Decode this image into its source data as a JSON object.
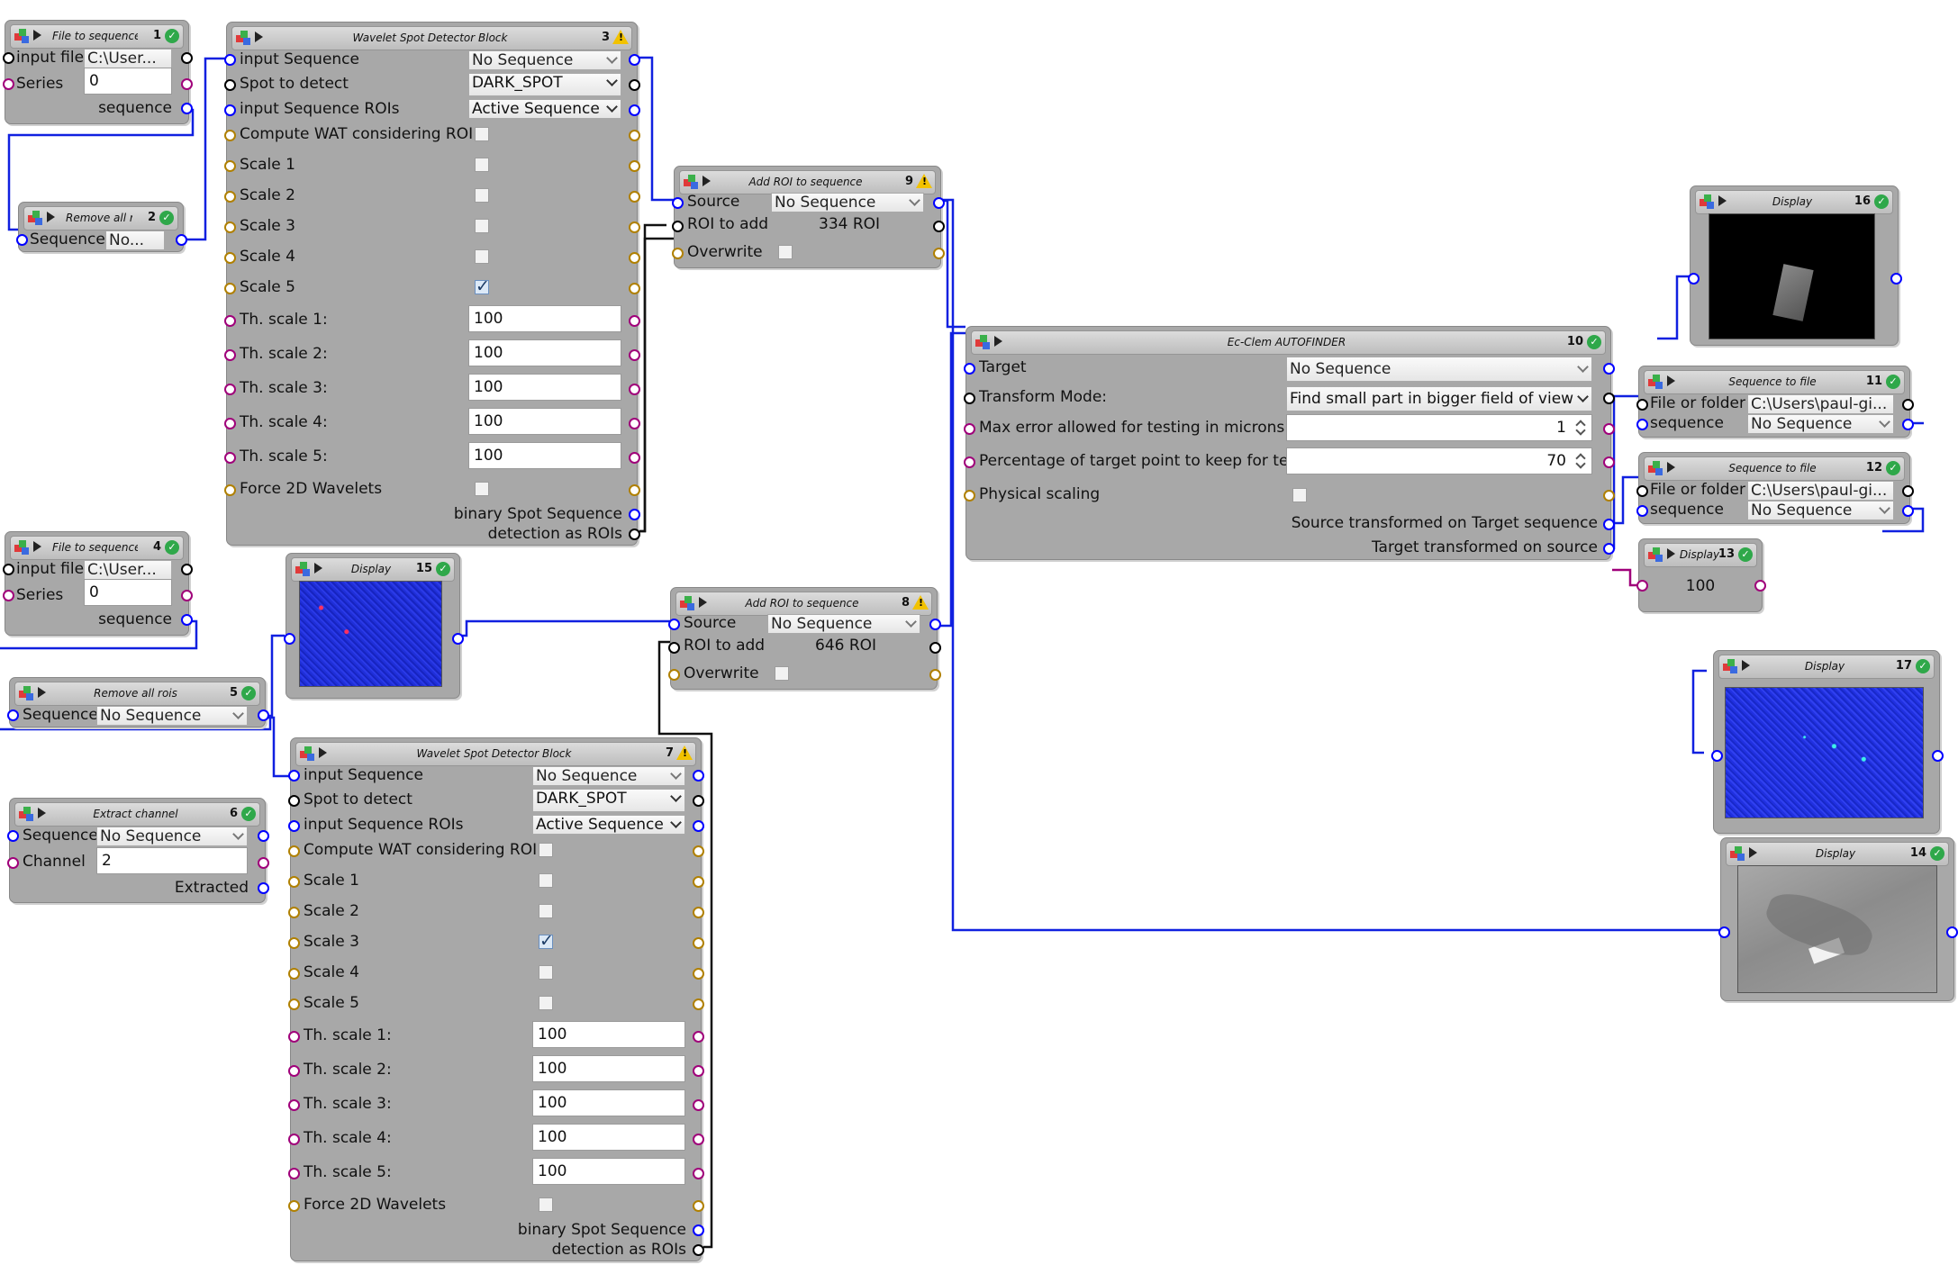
{
  "blocks": {
    "b1": {
      "title": "File to sequence",
      "num": "1",
      "labels": {
        "input_file": "input file",
        "series": "Series",
        "out": "sequence"
      },
      "values": {
        "file": "C:\\User...",
        "series": "0"
      }
    },
    "b2": {
      "title": "Remove all rois",
      "num": "2",
      "labels": {
        "seq": "Sequence"
      },
      "values": {
        "seq": "No..."
      }
    },
    "b3": {
      "title": "Wavelet Spot Detector Block",
      "num": "3",
      "rows": [
        "input Sequence",
        "Spot to detect",
        "input Sequence ROIs",
        "Compute WAT considering ROI",
        "Scale 1",
        "Scale 2",
        "Scale 3",
        "Scale 4",
        "Scale 5",
        "Th. scale 1:",
        "Th. scale 2:",
        "Th. scale 3:",
        "Th. scale 4:",
        "Th. scale 5:",
        "Force 2D Wavelets"
      ],
      "combos": [
        "No Sequence",
        "DARK_SPOT",
        "Active Sequence"
      ],
      "thresholds": [
        "100",
        "100",
        "100",
        "100",
        "100"
      ],
      "outputs": [
        "binary Spot Sequence",
        "detection as ROIs"
      ]
    },
    "b4": {
      "title": "File to sequence",
      "num": "4",
      "labels": {
        "input_file": "input file",
        "series": "Series",
        "out": "sequence"
      },
      "values": {
        "file": "C:\\User...",
        "series": "0"
      }
    },
    "b5": {
      "title": "Remove all rois",
      "num": "5",
      "labels": {
        "seq": "Sequence"
      },
      "values": {
        "seq": "No Sequence"
      }
    },
    "b6": {
      "title": "Extract channel",
      "num": "6",
      "labels": {
        "seq": "Sequence",
        "channel": "Channel",
        "out": "Extracted"
      },
      "values": {
        "seq": "No Sequence",
        "channel": "2"
      }
    },
    "b7": {
      "title": "Wavelet Spot Detector Block",
      "num": "7",
      "rows": [
        "input Sequence",
        "Spot to detect",
        "input Sequence ROIs",
        "Compute WAT considering ROI",
        "Scale 1",
        "Scale 2",
        "Scale 3",
        "Scale 4",
        "Scale 5",
        "Th. scale 1:",
        "Th. scale 2:",
        "Th. scale 3:",
        "Th. scale 4:",
        "Th. scale 5:",
        "Force 2D Wavelets"
      ],
      "combos": [
        "No Sequence",
        "DARK_SPOT",
        "Active Sequence"
      ],
      "thresholds": [
        "100",
        "100",
        "100",
        "100",
        "100"
      ],
      "outputs": [
        "binary Spot Sequence",
        "detection as ROIs"
      ]
    },
    "b8": {
      "title": "Add ROI to sequence",
      "num": "8",
      "labels": {
        "source": "Source",
        "roi": "ROI to add",
        "overwrite": "Overwrite"
      },
      "values": {
        "source": "No Sequence",
        "roi": "646 ROI"
      }
    },
    "b9": {
      "title": "Add ROI to sequence",
      "num": "9",
      "labels": {
        "source": "Source",
        "roi": "ROI to add",
        "overwrite": "Overwrite"
      },
      "values": {
        "source": "No Sequence",
        "roi": "334 ROI"
      }
    },
    "b10": {
      "title": "Ec-Clem AUTOFINDER",
      "num": "10",
      "labels": {
        "target": "Target",
        "mode": "Transform Mode:",
        "maxerr": "Max error allowed for testing in microns",
        "pct": "Percentage of target point to keep for test",
        "phys": "Physical scaling",
        "out1": "Source transformed on Target sequence",
        "out2": "Target transformed on source"
      },
      "values": {
        "target": "No Sequence",
        "mode": "Find small part in bigger field of view",
        "maxerr": "1",
        "pct": "70"
      }
    },
    "b11": {
      "title": "Sequence to file",
      "num": "11",
      "labels": {
        "file": "File or folder",
        "seq": "sequence"
      },
      "values": {
        "file": "C:\\Users\\paul-gi...",
        "seq": "No Sequence"
      }
    },
    "b12": {
      "title": "Sequence to file",
      "num": "12",
      "labels": {
        "file": "File or folder",
        "seq": "sequence"
      },
      "values": {
        "file": "C:\\Users\\paul-gi...",
        "seq": "No Sequence"
      }
    },
    "b13": {
      "title": "Display",
      "num": "13",
      "value": "100"
    },
    "b14": {
      "title": "Display",
      "num": "14"
    },
    "b15": {
      "title": "Display",
      "num": "15"
    },
    "b16": {
      "title": "Display",
      "num": "16"
    },
    "b17": {
      "title": "Display",
      "num": "17"
    }
  },
  "colors": {
    "seq_port": "#0000ff",
    "roi_port": "#000000",
    "num_port": "#a0007a",
    "bool_port": "#b08000",
    "ok": "#2fa84a",
    "warn": "#f2c200"
  }
}
